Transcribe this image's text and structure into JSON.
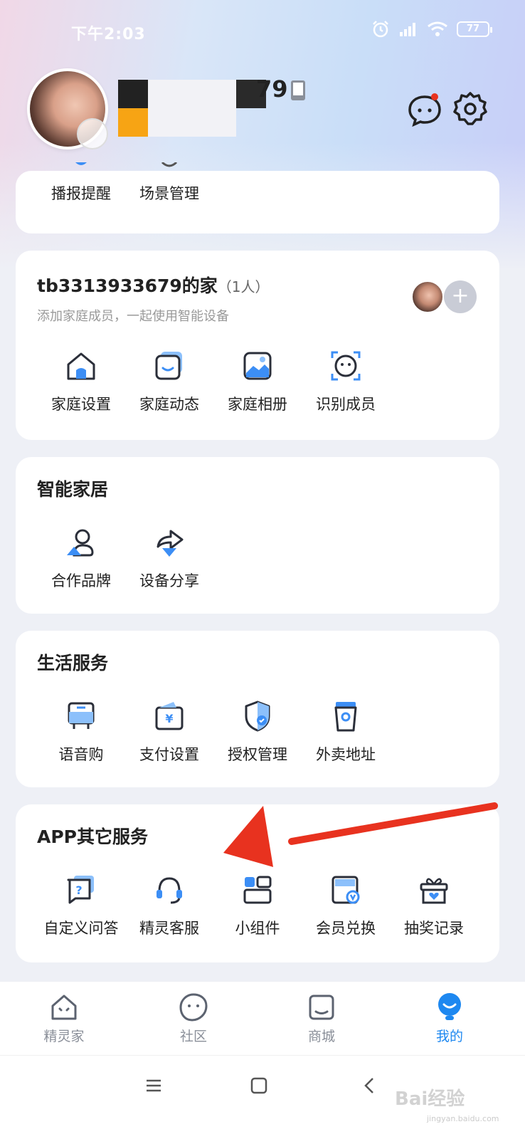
{
  "status_bar": {
    "time": "下午2:03",
    "battery": "77"
  },
  "profile": {
    "username_visible_suffix": "79"
  },
  "top_card": {
    "items": [
      {
        "label": "播报提醒",
        "icon": "broadcast-icon"
      },
      {
        "label": "场景管理",
        "icon": "scene-icon"
      }
    ]
  },
  "family": {
    "title": "tb3313933679的家",
    "count": "（1人）",
    "subtitle": "添加家庭成员，一起使用智能设备",
    "items": [
      {
        "label": "家庭设置",
        "icon": "home-settings-icon"
      },
      {
        "label": "家庭动态",
        "icon": "family-feed-icon"
      },
      {
        "label": "家庭相册",
        "icon": "family-album-icon"
      },
      {
        "label": "识别成员",
        "icon": "face-recognition-icon"
      }
    ]
  },
  "smart_home": {
    "title": "智能家居",
    "items": [
      {
        "label": "合作品牌",
        "icon": "partner-brand-icon"
      },
      {
        "label": "设备分享",
        "icon": "device-share-icon"
      }
    ]
  },
  "life_services": {
    "title": "生活服务",
    "items": [
      {
        "label": "语音购",
        "icon": "voice-shopping-icon"
      },
      {
        "label": "支付设置",
        "icon": "payment-settings-icon"
      },
      {
        "label": "授权管理",
        "icon": "authorization-icon"
      },
      {
        "label": "外卖地址",
        "icon": "takeout-address-icon"
      }
    ]
  },
  "app_services": {
    "title": "APP其它服务",
    "items": [
      {
        "label": "自定义问答",
        "icon": "custom-qa-icon"
      },
      {
        "label": "精灵客服",
        "icon": "customer-service-icon"
      },
      {
        "label": "小组件",
        "icon": "widget-icon"
      },
      {
        "label": "会员兑换",
        "icon": "member-redeem-icon"
      },
      {
        "label": "抽奖记录",
        "icon": "lottery-record-icon"
      }
    ]
  },
  "tabs": [
    {
      "label": "精灵家",
      "icon": "home-tab-icon",
      "active": false
    },
    {
      "label": "社区",
      "icon": "community-tab-icon",
      "active": false
    },
    {
      "label": "商城",
      "icon": "mall-tab-icon",
      "active": false
    },
    {
      "label": "我的",
      "icon": "profile-tab-icon",
      "active": true
    }
  ],
  "watermark": {
    "text": "Bai经验",
    "sub": "jingyan.baidu.com"
  },
  "colors": {
    "accent": "#1e88f0",
    "annotation_arrow": "#e8321f"
  }
}
